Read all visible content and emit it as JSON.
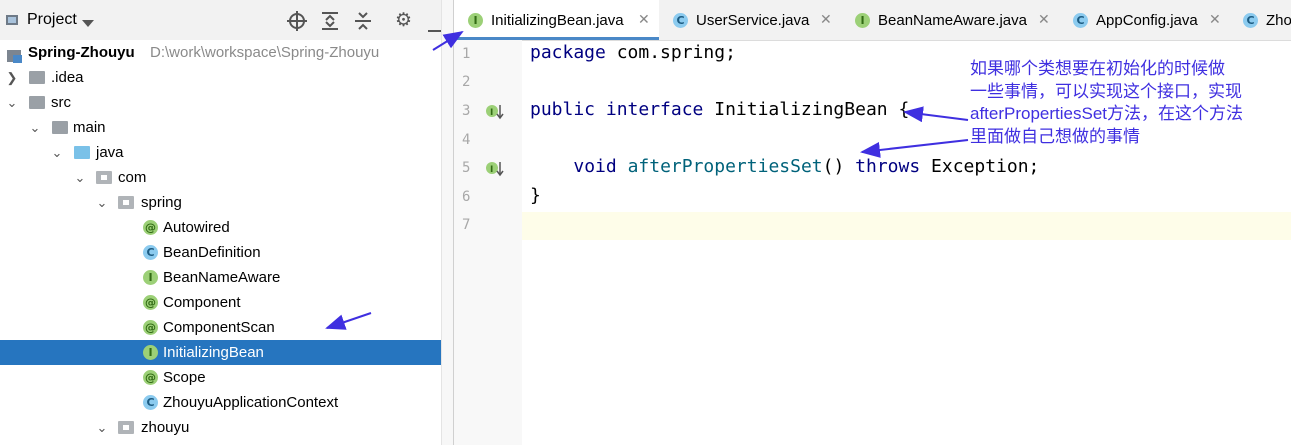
{
  "project_panel": {
    "title": "Project",
    "root": {
      "name": "Spring-Zhouyu",
      "path": "D:\\work\\workspace\\Spring-Zhouyu"
    },
    "tree": [
      {
        "label": ".idea",
        "type": "folder",
        "depth": 1,
        "expanded": false
      },
      {
        "label": "src",
        "type": "folder",
        "depth": 1,
        "expanded": true
      },
      {
        "label": "main",
        "type": "folder",
        "depth": 2,
        "expanded": true
      },
      {
        "label": "java",
        "type": "source-folder",
        "depth": 3,
        "expanded": true
      },
      {
        "label": "com",
        "type": "package",
        "depth": 4,
        "expanded": true
      },
      {
        "label": "spring",
        "type": "package",
        "depth": 5,
        "expanded": true
      },
      {
        "label": "Autowired",
        "type": "annotation",
        "depth": 6
      },
      {
        "label": "BeanDefinition",
        "type": "class",
        "depth": 6
      },
      {
        "label": "BeanNameAware",
        "type": "interface",
        "depth": 6
      },
      {
        "label": "Component",
        "type": "annotation",
        "depth": 6
      },
      {
        "label": "ComponentScan",
        "type": "annotation",
        "depth": 6
      },
      {
        "label": "InitializingBean",
        "type": "interface",
        "depth": 6,
        "selected": true
      },
      {
        "label": "Scope",
        "type": "annotation",
        "depth": 6
      },
      {
        "label": "ZhouyuApplicationContext",
        "type": "class",
        "depth": 6
      },
      {
        "label": "zhouyu",
        "type": "package",
        "depth": 5,
        "expanded": true
      }
    ]
  },
  "tabs": [
    {
      "label": "InitializingBean.java",
      "type": "interface",
      "active": true
    },
    {
      "label": "UserService.java",
      "type": "class"
    },
    {
      "label": "BeanNameAware.java",
      "type": "interface"
    },
    {
      "label": "AppConfig.java",
      "type": "class"
    },
    {
      "label": "Zho",
      "type": "class"
    }
  ],
  "code": {
    "lines": [
      {
        "n": "1",
        "text": "package com.spring;"
      },
      {
        "n": "2",
        "text": ""
      },
      {
        "n": "3",
        "kw": "public interface",
        "rest": " InitializingBean {"
      },
      {
        "n": "4",
        "text": ""
      },
      {
        "n": "5",
        "kw1": "void",
        "fn": "afterPropertiesSet",
        "mid": "() ",
        "kw2": "throws",
        "rest": " Exception;"
      },
      {
        "n": "6",
        "text": "}"
      },
      {
        "n": "7",
        "text": ""
      }
    ]
  },
  "annotation": {
    "lines": [
      "如果哪个类想要在初始化的时候做",
      "一些事情，可以实现这个接口，实现",
      "afterPropertiesSet方法，在这个方法",
      "里面做自己想做的事情"
    ]
  },
  "colors": {
    "selection": "#2675bf",
    "annotation": "#3f2fe0",
    "keyword": "#000080"
  }
}
